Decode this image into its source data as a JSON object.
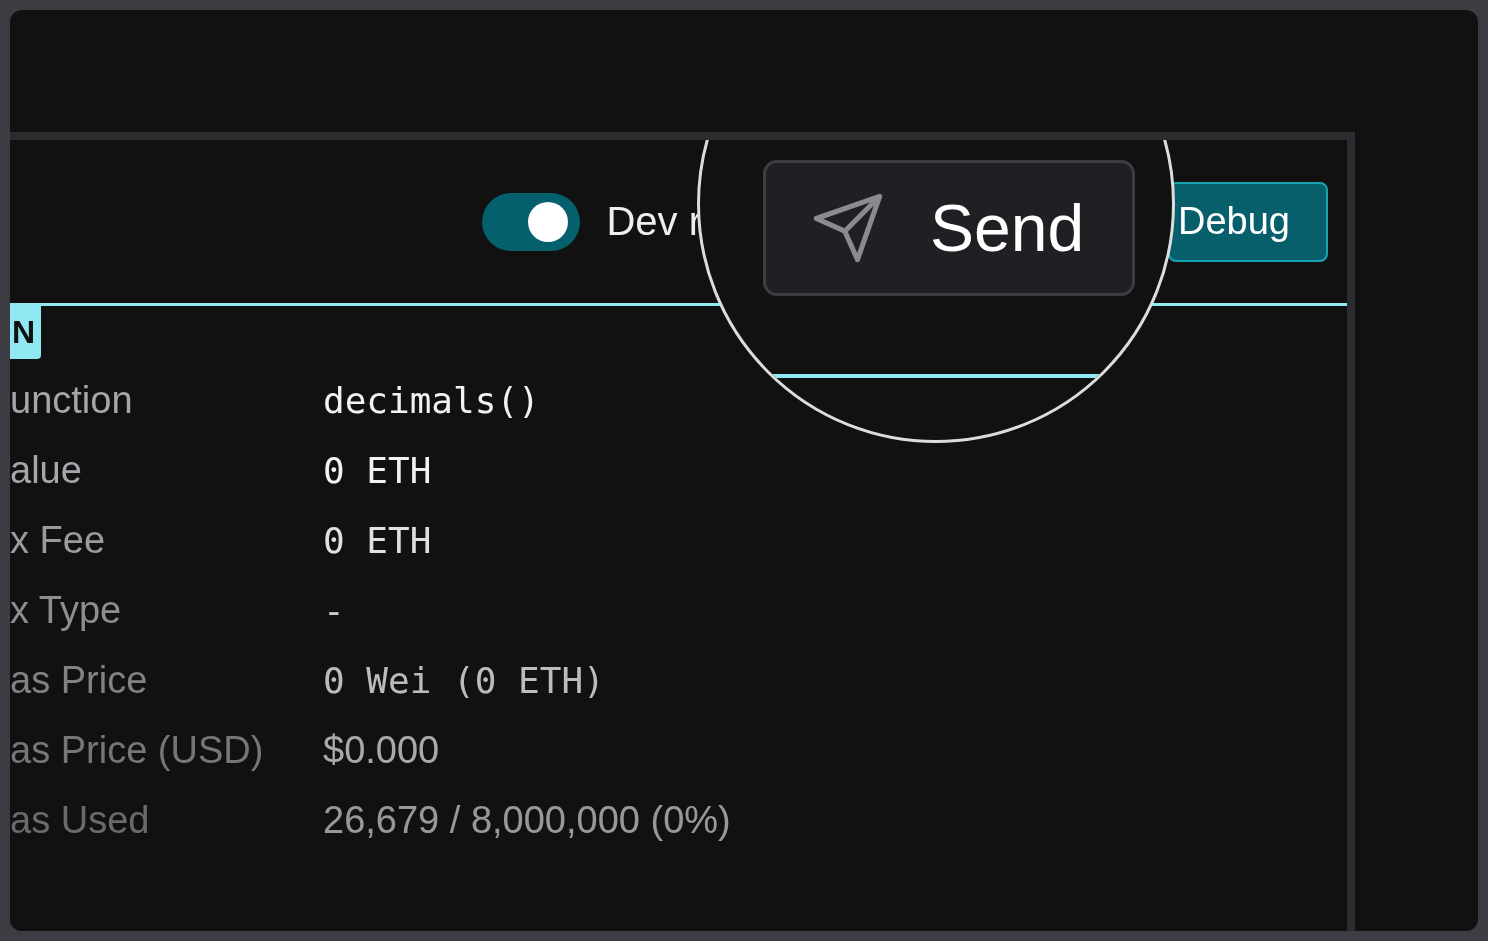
{
  "header": {
    "toggle": {
      "on": true
    },
    "toggle_label": "Dev r",
    "debug_button": "Debug"
  },
  "section_tag": "N",
  "details": [
    {
      "label": "unction",
      "value": "decimals()",
      "kind": "mono"
    },
    {
      "label": "alue",
      "value": "0 ETH",
      "kind": "mono"
    },
    {
      "label": "x Fee",
      "value": "0 ETH",
      "kind": "mono"
    },
    {
      "label": "x Type",
      "value": "-",
      "kind": "mono"
    },
    {
      "label": "as Price",
      "value": "0 Wei (0 ETH)",
      "kind": "mono"
    },
    {
      "label": "as Price (USD)",
      "value": "$0.000",
      "kind": "sans"
    },
    {
      "label": "as Used",
      "value": "26,679 / 8,000,000 (0%)",
      "kind": "sans"
    }
  ],
  "magnifier": {
    "button": "Send"
  }
}
